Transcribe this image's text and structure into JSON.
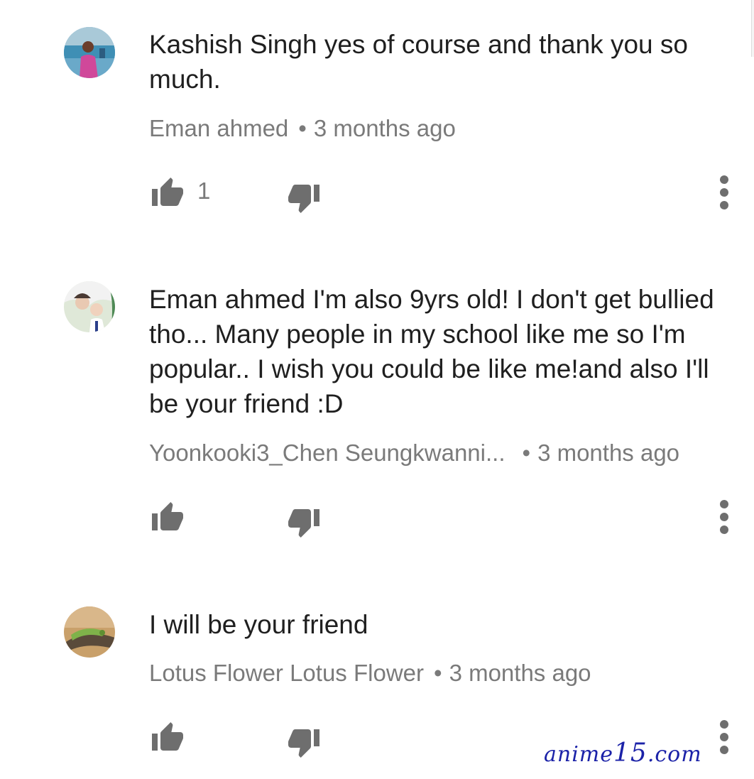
{
  "comments": [
    {
      "text": "Kashish Singh yes of course and thank you so much.",
      "author": "Eman ahmed",
      "time": "3 months ago",
      "like_count": "1"
    },
    {
      "text": "Eman ahmed I'm also 9yrs old! I don't get bullied tho... Many people in my school like me so I'm popular.. I wish you could be like me!and also I'll be your friend :D",
      "author": "Yoonkooki3_Chen Seungkwanni...",
      "time": "3 months ago",
      "like_count": ""
    },
    {
      "text": "I will be your friend",
      "author": "Lotus Flower Lotus Flower",
      "time": "3 months ago",
      "like_count": ""
    }
  ],
  "separator": "•",
  "watermark": {
    "prefix": "anime",
    "number": "15",
    "suffix": ".com"
  },
  "colors": {
    "text": "#1f1f1f",
    "meta": "#7a7a7a",
    "icon": "#6e6e6e",
    "watermark": "#1b22a8"
  },
  "icons": [
    "thumb-up-icon",
    "thumb-down-icon",
    "more-vert-icon"
  ]
}
